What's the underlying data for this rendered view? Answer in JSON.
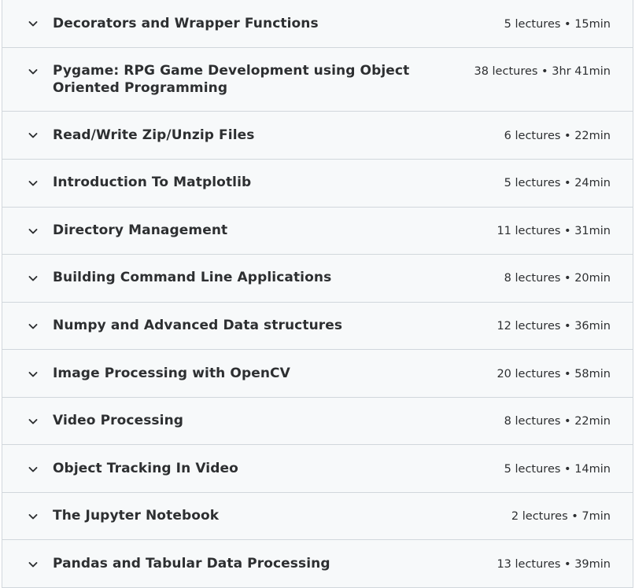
{
  "sections": [
    {
      "title": "Decorators and Wrapper Functions",
      "lectures": "5 lectures",
      "duration": "15min",
      "meta": "5 lectures • 15min"
    },
    {
      "title": "Pygame: RPG Game Development using Object Oriented Programming",
      "lectures": "38 lectures",
      "duration": "3hr 41min",
      "meta": "38 lectures • 3hr 41min"
    },
    {
      "title": "Read/Write Zip/Unzip Files",
      "lectures": "6 lectures",
      "duration": "22min",
      "meta": "6 lectures • 22min"
    },
    {
      "title": "Introduction To Matplotlib",
      "lectures": "5 lectures",
      "duration": "24min",
      "meta": "5 lectures • 24min"
    },
    {
      "title": "Directory Management",
      "lectures": "11 lectures",
      "duration": "31min",
      "meta": "11 lectures • 31min"
    },
    {
      "title": "Building Command Line Applications",
      "lectures": "8 lectures",
      "duration": "20min",
      "meta": "8 lectures • 20min"
    },
    {
      "title": "Numpy and Advanced Data structures",
      "lectures": "12 lectures",
      "duration": "36min",
      "meta": "12 lectures • 36min"
    },
    {
      "title": "Image Processing with OpenCV",
      "lectures": "20 lectures",
      "duration": "58min",
      "meta": "20 lectures • 58min"
    },
    {
      "title": "Video Processing",
      "lectures": "8 lectures",
      "duration": "22min",
      "meta": "8 lectures • 22min"
    },
    {
      "title": "Object Tracking In Video",
      "lectures": "5 lectures",
      "duration": "14min",
      "meta": "5 lectures • 14min"
    },
    {
      "title": "The Jupyter Notebook",
      "lectures": "2 lectures",
      "duration": "7min",
      "meta": "2 lectures • 7min"
    },
    {
      "title": "Pandas and Tabular Data Processing",
      "lectures": "13 lectures",
      "duration": "39min",
      "meta": "13 lectures • 39min"
    }
  ],
  "icons": {
    "expand": "chevron-down-icon"
  },
  "colors": {
    "row_background": "#f7f9fa",
    "divider": "#d1d7dc",
    "text": "#2d2f31"
  }
}
